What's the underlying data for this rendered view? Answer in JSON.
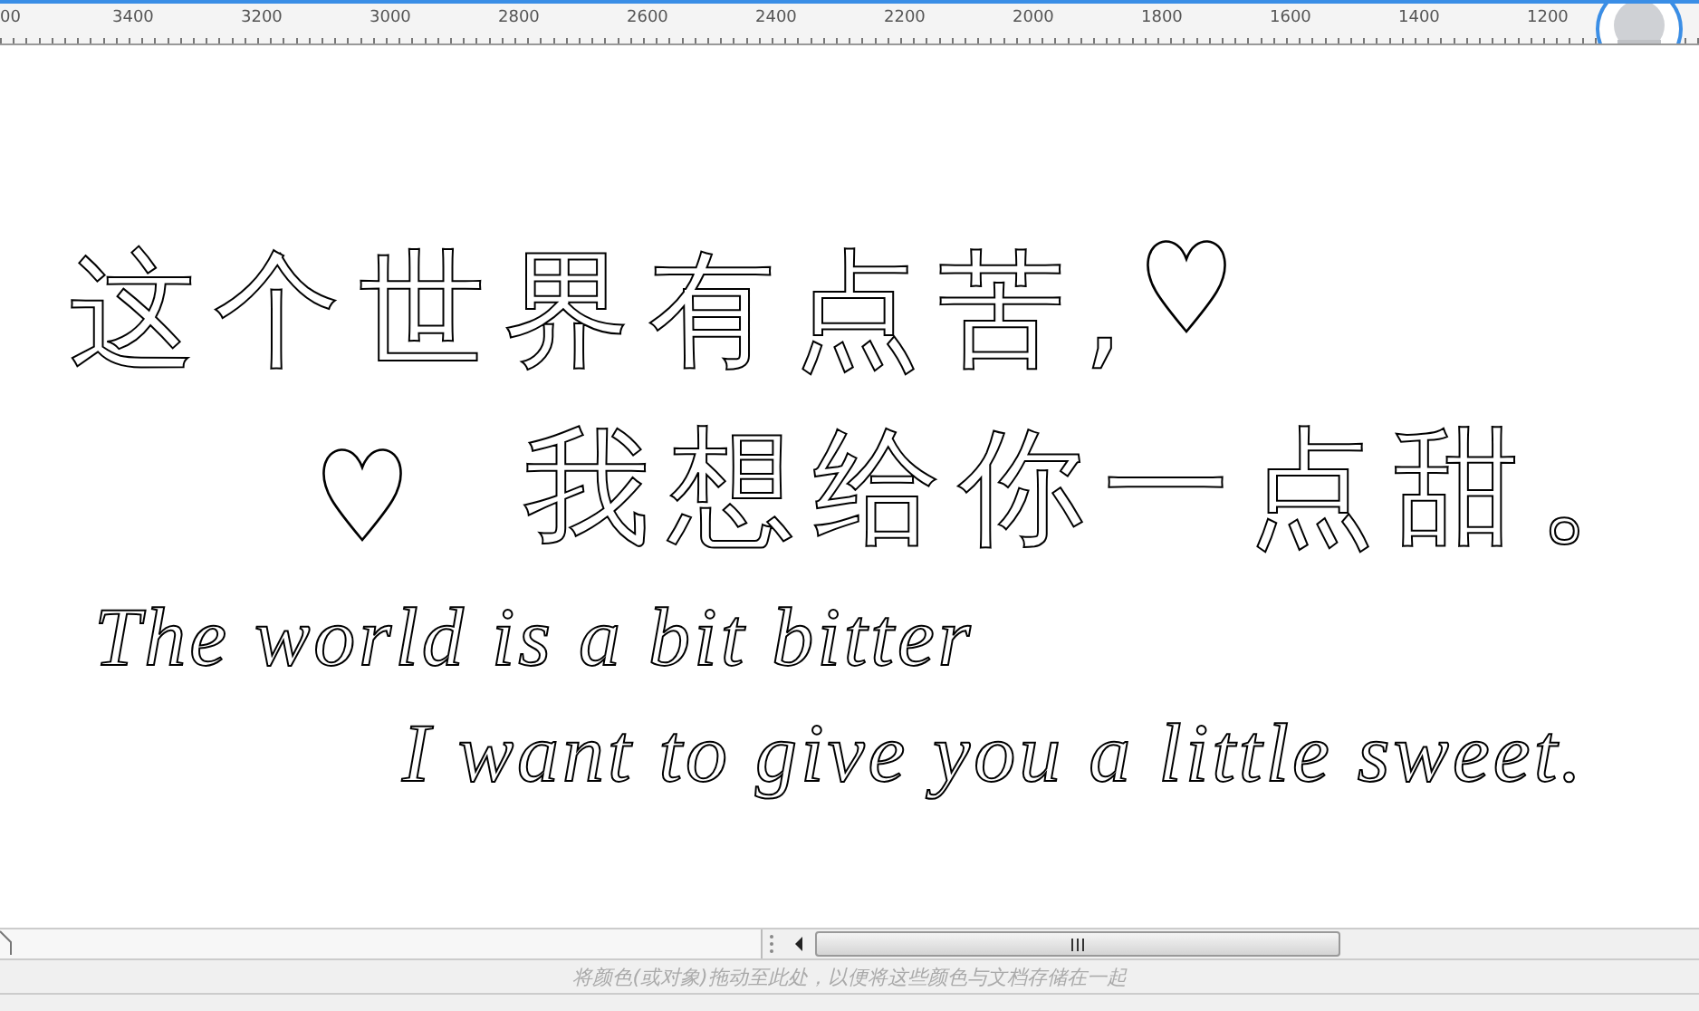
{
  "ruler": {
    "labels": [
      "00",
      "3400",
      "3200",
      "3000",
      "2800",
      "2600",
      "2400",
      "2200",
      "2000",
      "1800",
      "1600",
      "1400",
      "1200"
    ]
  },
  "lines": [
    {
      "kind": "cjk",
      "items": [
        {
          "kind": "text",
          "text": "这个世界有点苦,"
        },
        {
          "kind": "heart"
        }
      ]
    },
    {
      "kind": "cjk",
      "items": [
        {
          "kind": "heart"
        },
        {
          "kind": "text",
          "text": "我想给你一点甜。"
        }
      ]
    },
    {
      "kind": "latin",
      "items": [
        {
          "kind": "text",
          "text": "The world is a bit bitter"
        }
      ]
    },
    {
      "kind": "latin",
      "items": [
        {
          "kind": "text",
          "text": "I want to give you a little sweet."
        }
      ]
    }
  ],
  "status_bar": {
    "hint": "将颜色(或对象)拖动至此处，以便将这些颜色与文档存储在一起"
  }
}
